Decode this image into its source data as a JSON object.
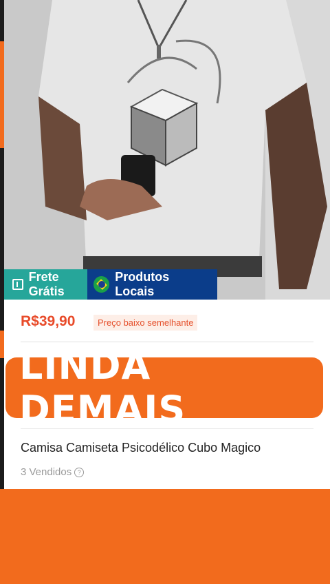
{
  "badges": {
    "frete": "Frete Grátis",
    "locais": "Produtos Locais"
  },
  "product": {
    "price": "R$39,90",
    "price_note": "Preço baixo semelhante",
    "banner": "LINDA DEMAIS",
    "title": "Camisa Camiseta Psicodélico Cubo Magico",
    "sold": "3 Vendidos",
    "help_glyph": "?"
  },
  "colors": {
    "accent_orange": "#f26b1d",
    "frete_green": "#26a69a",
    "locais_blue": "#0b3d8a",
    "price_red": "#e84b2a"
  }
}
